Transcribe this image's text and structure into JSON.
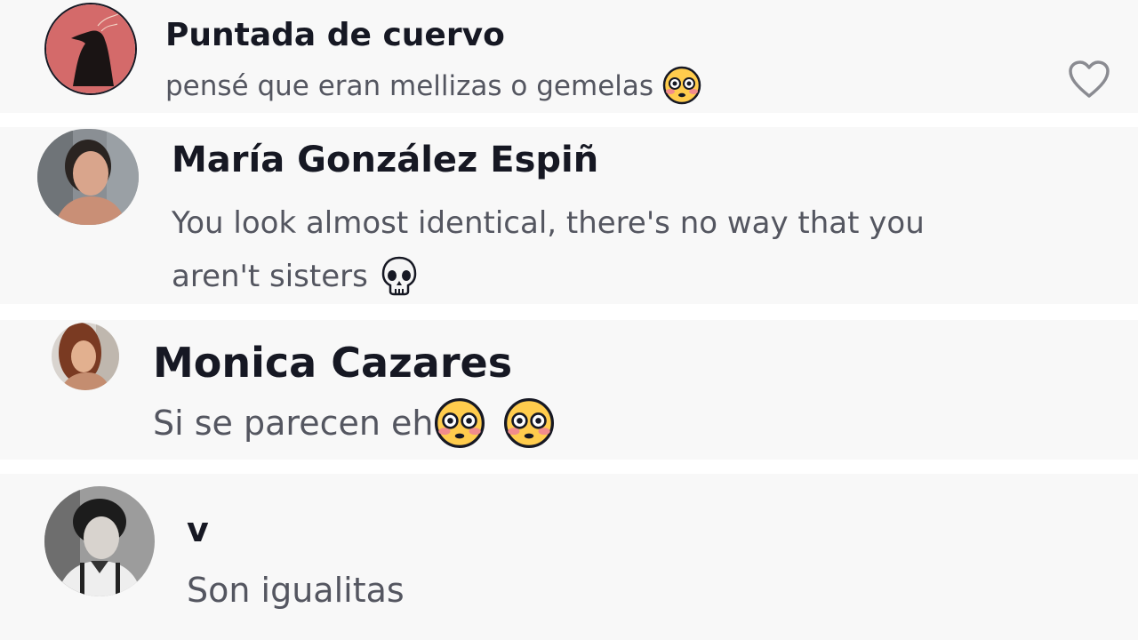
{
  "comments": [
    {
      "username": "Puntada de cuervo",
      "text": "pensé que eran mellizas o gemelas",
      "emojis": [
        "flushed-face"
      ],
      "avatar": "crow-avatar",
      "accent": "#d46a6a"
    },
    {
      "username": "María González Espiñ",
      "text_line1": "You look almost identical, there's no way that you",
      "text_line2": "aren't sisters",
      "emojis": [
        "skull"
      ],
      "avatar": "photo-avatar"
    },
    {
      "username": "Monica Cazares",
      "text": "Si se parecen eh",
      "emojis": [
        "flushed-face",
        "flushed-face"
      ],
      "avatar": "photo-avatar"
    },
    {
      "username": "v",
      "text": "Son igualitas",
      "avatar": "photo-avatar"
    }
  ],
  "colors": {
    "row_background": "#f8f8f8",
    "separator": "#ffffff",
    "username": "#161823",
    "comment_text": "#545660",
    "like_icon": "#8a8b91"
  },
  "icons": {
    "like": "heart-outline-icon"
  }
}
